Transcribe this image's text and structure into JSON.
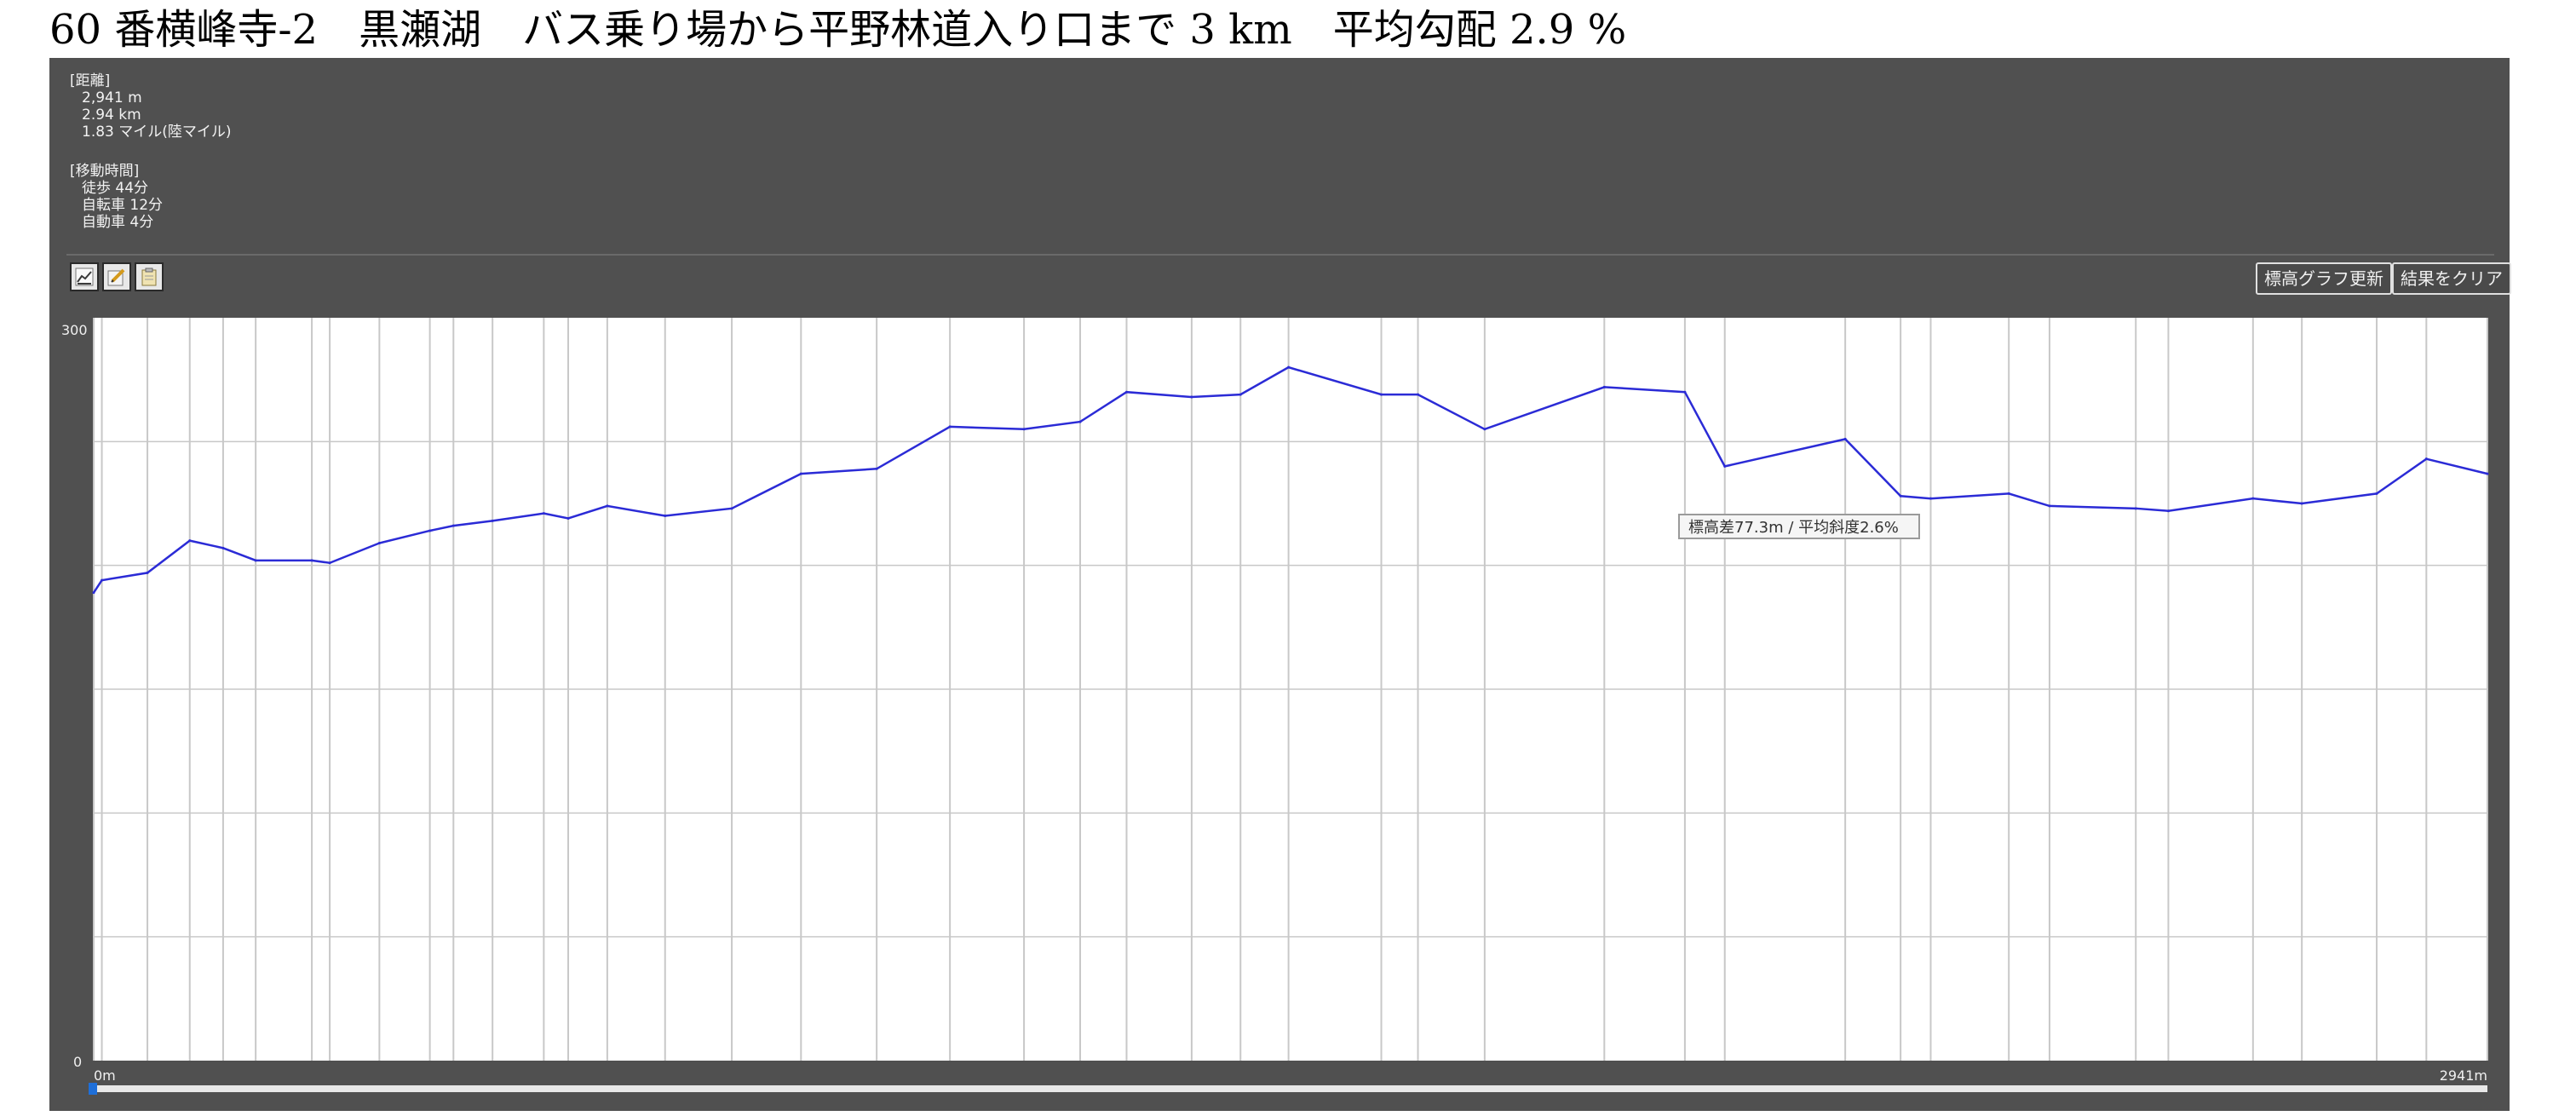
{
  "page": {
    "title": "60 番横峰寺-2　黒瀬湖　バス乗り場から平野林道入り口まで 3 km　平均勾配 2.9 %"
  },
  "info": {
    "distance_heading": "[距離]",
    "distance_m": "2,941 m",
    "distance_km": "2.94 km",
    "distance_mile": "1.83 マイル(陸マイル)",
    "time_heading": "[移動時間]",
    "time_walk": "徒歩 44分",
    "time_bike": "自転車 12分",
    "time_car": "自動車 4分"
  },
  "toolbar": {
    "icons": [
      "chart-icon",
      "edit-icon",
      "clipboard-icon"
    ],
    "update_label": "標高グラフ更新",
    "clear_label": "結果をクリア"
  },
  "tooltip": {
    "text": "標高差77.3m / 平均斜度2.6%"
  },
  "colors": {
    "line": "#2b2bd6",
    "panel": "#505050",
    "plot_bg": "#ffffff",
    "grid": "#c8c8c8"
  },
  "chart_data": {
    "type": "line",
    "title": "",
    "xlabel": "",
    "ylabel": "",
    "xlim": [
      0,
      2941
    ],
    "ylim": [
      0,
      300
    ],
    "y_tick_labels": [
      "300",
      "0"
    ],
    "x_tick_labels": [
      "0m",
      "2941m"
    ],
    "grid": true,
    "series": [
      {
        "x": [
          0,
          10,
          66,
          118,
          159,
          199,
          268,
          290,
          351,
          413,
          442,
          490,
          553,
          583,
          631,
          702,
          784,
          869,
          962,
          1052,
          1143,
          1212,
          1269,
          1349,
          1409,
          1468,
          1582,
          1627,
          1709,
          1856,
          1955,
          2004,
          2152,
          2220,
          2257,
          2353,
          2403,
          2509,
          2549,
          2653,
          2713,
          2805,
          2866,
          2941
        ],
        "y": [
          189,
          194,
          197,
          210,
          207,
          202,
          202,
          201,
          209,
          214,
          216,
          218,
          221,
          219,
          224,
          220,
          223,
          237,
          239,
          256,
          255,
          258,
          270,
          268,
          269,
          280,
          269,
          269,
          255,
          272,
          270,
          240,
          251,
          228,
          227,
          229,
          224,
          223,
          222,
          227,
          225,
          229,
          243,
          237
        ]
      }
    ],
    "series_extra": {
      "x": [],
      "y": []
    }
  }
}
